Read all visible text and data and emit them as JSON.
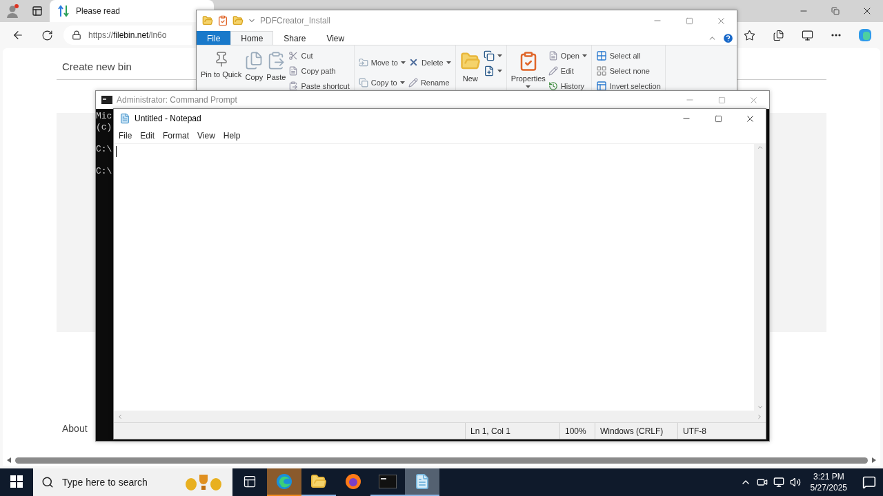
{
  "browser": {
    "tab": {
      "title": "Please read",
      "selected": true
    },
    "address": "https://**filebin.net**/ln6o",
    "page": {
      "heading": "Create new bin",
      "footer_link": "About"
    }
  },
  "explorer": {
    "title": "PDFCreator_Install",
    "tabs": [
      {
        "label": "File",
        "kind": "file",
        "selected": false
      },
      {
        "label": "Home",
        "kind": "tab",
        "selected": true
      },
      {
        "label": "Share",
        "kind": "tab",
        "selected": false
      },
      {
        "label": "View",
        "kind": "tab",
        "selected": false
      }
    ],
    "groups": [
      {
        "columns": [
          {
            "kind": "large",
            "items": [
              {
                "label": "Pin to Quick",
                "dropdown": false
              }
            ]
          },
          {
            "kind": "large",
            "items": [
              {
                "label": "Copy",
                "dropdown": false
              }
            ]
          },
          {
            "kind": "large",
            "items": [
              {
                "label": "Paste",
                "dropdown": false
              }
            ]
          },
          {
            "kind": "stack",
            "items": [
              {
                "label": "Cut",
                "dropdown": false
              },
              {
                "label": "Copy path",
                "dropdown": false
              },
              {
                "label": "Paste shortcut",
                "dropdown": false
              }
            ]
          }
        ]
      },
      {
        "columns": [
          {
            "kind": "pair",
            "items": [
              {
                "label": "Move to",
                "dropdown": true
              },
              {
                "label": "Copy to",
                "dropdown": true
              }
            ]
          },
          {
            "kind": "pair",
            "items": [
              {
                "label": "Delete",
                "dropdown": true
              },
              {
                "label": "Rename",
                "dropdown": false
              }
            ]
          }
        ]
      },
      {
        "columns": [
          {
            "kind": "large",
            "items": [
              {
                "label": "New",
                "dropdown": false
              }
            ]
          },
          {
            "kind": "icons",
            "items": [
              {
                "dropdown": true
              },
              {
                "dropdown": true
              }
            ]
          }
        ]
      },
      {
        "columns": [
          {
            "kind": "large",
            "items": [
              {
                "label": "Properties",
                "dropdown": true
              }
            ]
          },
          {
            "kind": "stack",
            "items": [
              {
                "label": "Open",
                "dropdown": true
              },
              {
                "label": "Edit",
                "dropdown": false
              },
              {
                "label": "History",
                "dropdown": false
              }
            ]
          }
        ]
      },
      {
        "columns": [
          {
            "kind": "stack",
            "items": [
              {
                "label": "Select all",
                "dropdown": false
              },
              {
                "label": "Select none",
                "dropdown": false
              },
              {
                "label": "Invert selection",
                "dropdown": false
              }
            ]
          }
        ]
      }
    ]
  },
  "command_prompt": {
    "title": "Administrator: Command Prompt",
    "lines": [
      {
        "text": "Mic",
        "blank_before": false
      },
      {
        "text": "(c)",
        "blank_before": false
      },
      {
        "text": "C:\\",
        "blank_before": true
      },
      {
        "text": "C:\\",
        "blank_before": true
      }
    ]
  },
  "notepad": {
    "title": "Untitled - Notepad",
    "menu": [
      "File",
      "Edit",
      "Format",
      "View",
      "Help"
    ],
    "status": [
      "Ln 1, Col 1",
      "100%",
      "Windows (CRLF)",
      "UTF-8"
    ]
  },
  "taskbar": {
    "search_placeholder": "Type here to search",
    "apps": [
      {
        "kind": "taskview",
        "selected": false,
        "running": false,
        "flashing": false
      },
      {
        "kind": "edge",
        "selected": false,
        "running": true,
        "flashing": true
      },
      {
        "kind": "explorer",
        "selected": false,
        "running": true,
        "flashing": false
      },
      {
        "kind": "firefox",
        "selected": false,
        "running": false,
        "flashing": false
      },
      {
        "kind": "cmd",
        "selected": false,
        "running": true,
        "flashing": false
      },
      {
        "kind": "notepad",
        "selected": true,
        "running": true,
        "flashing": false
      }
    ],
    "time": "3:21 PM",
    "date": "5/27/2025"
  }
}
